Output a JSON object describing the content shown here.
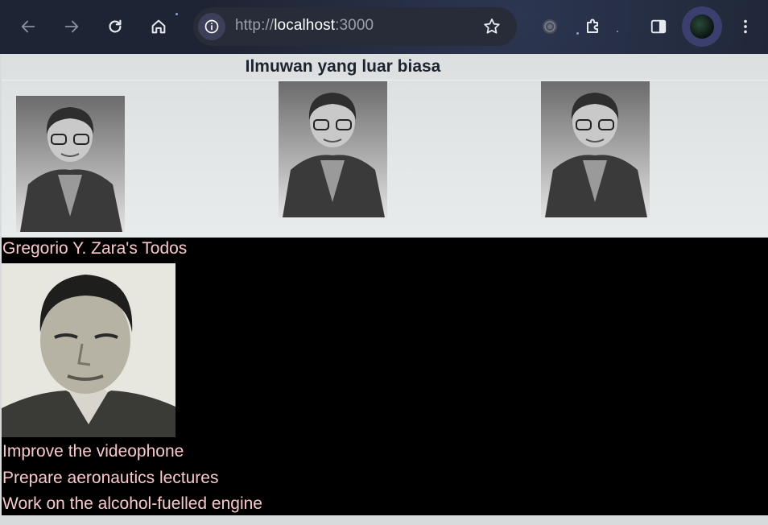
{
  "browser": {
    "url_scheme": "http://",
    "url_host": "localhost",
    "url_port": ":3000",
    "icons": [
      "back-icon",
      "forward-icon",
      "reload-icon",
      "home-icon",
      "site-info-icon",
      "bookmark-star-icon",
      "extension-icon",
      "puzzle-extensions-icon",
      "side-panel-icon",
      "profile-avatar",
      "menu-kebab-icon"
    ]
  },
  "gallery": {
    "title": "Ilmuwan yang luar biasa"
  },
  "profile": {
    "title": "Gregorio Y. Zara's Todos",
    "todos": [
      "Improve the videophone",
      "Prepare aeronautics lectures",
      "Work on the alcohol-fuelled engine"
    ]
  },
  "colors": {
    "toolbar_bg": "#1d2433",
    "page_bg": "#d7dbdc",
    "section_bg": "#000000",
    "todo_text": "#f7c8cc",
    "heading_text": "#1c2430"
  }
}
